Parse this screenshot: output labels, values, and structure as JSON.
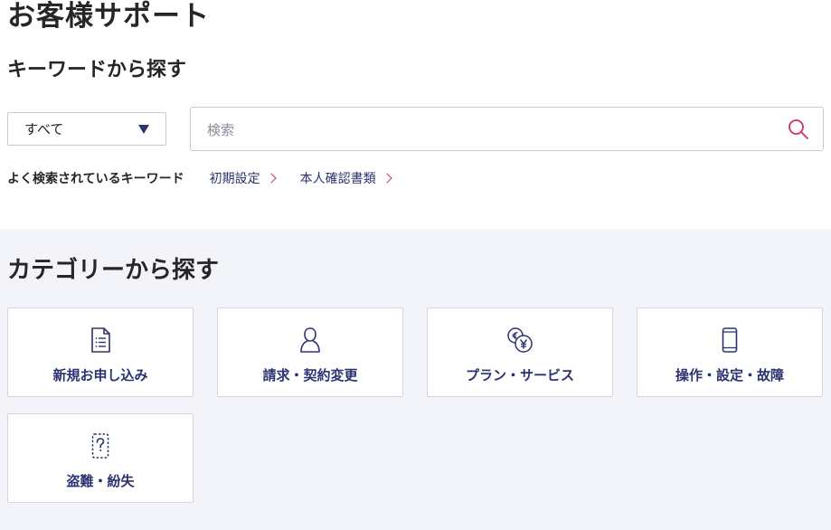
{
  "page": {
    "title": "お客様サポート"
  },
  "keyword_search": {
    "heading": "キーワードから探す",
    "category_select": {
      "selected": "すべて"
    },
    "search": {
      "placeholder": "検索"
    },
    "popular": {
      "label": "よく検索されているキーワード",
      "links": [
        "初期設定",
        "本人確認書類"
      ]
    }
  },
  "category_search": {
    "heading": "カテゴリーから探す",
    "cards": [
      {
        "label": "新規お申し込み",
        "icon": "document-list-icon"
      },
      {
        "label": "請求・契約変更",
        "icon": "person-icon"
      },
      {
        "label": "プラン・サービス",
        "icon": "yen-coins-icon"
      },
      {
        "label": "操作・設定・故障",
        "icon": "smartphone-icon"
      },
      {
        "label": "盗難・紛失",
        "icon": "question-card-icon"
      }
    ]
  },
  "colors": {
    "accent": "#2b3370",
    "highlight": "#d0306a",
    "panel_background": "#f3f3fa",
    "border": "#c9c9c9"
  }
}
